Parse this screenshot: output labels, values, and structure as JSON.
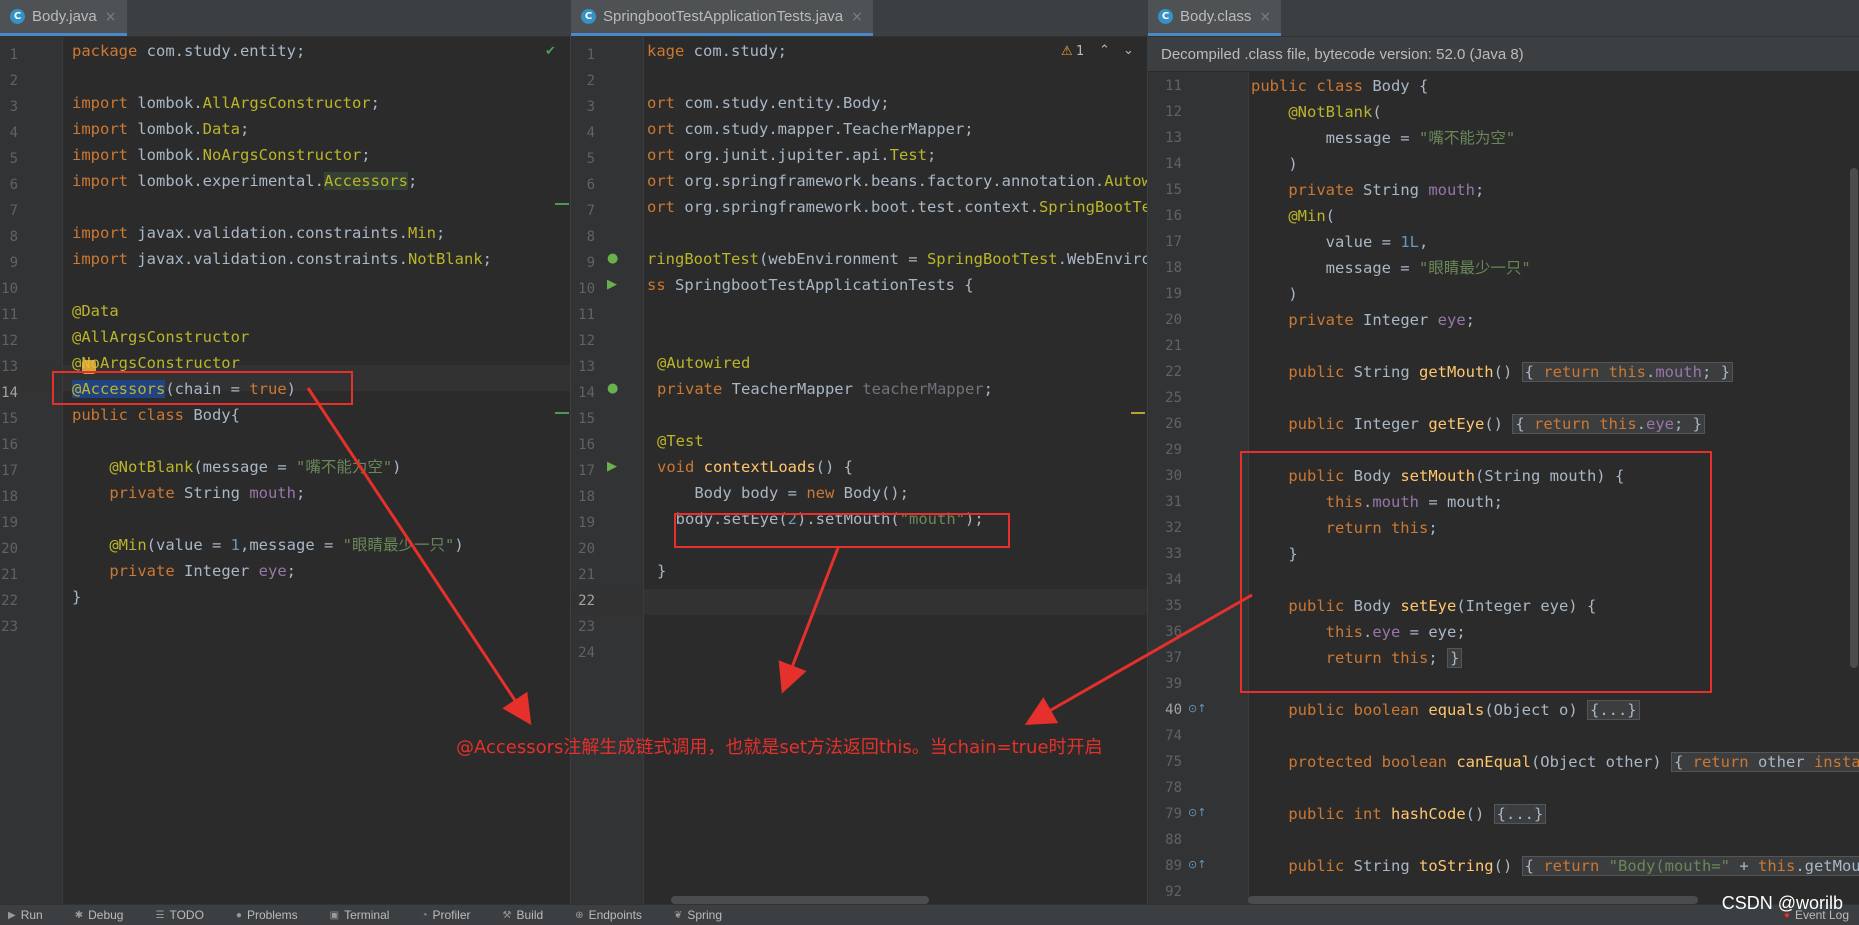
{
  "panes": [
    {
      "tab": {
        "letter": "C",
        "name": "Body.java",
        "close": "×"
      },
      "line_numbers": [
        "1",
        "2",
        "3",
        "4",
        "5",
        "6",
        "7",
        "8",
        "9",
        "10",
        "11",
        "12",
        "13",
        "14",
        "15",
        "16",
        "17",
        "18",
        "19",
        "20",
        "21",
        "22",
        "23"
      ],
      "current_line": "14",
      "checkmark": "✔"
    },
    {
      "tab": {
        "letter": "C",
        "name": "SpringbootTestApplicationTests.java",
        "close": "×"
      },
      "line_numbers": [
        "1",
        "2",
        "3",
        "4",
        "5",
        "6",
        "7",
        "8",
        "9",
        "10",
        "11",
        "12",
        "13",
        "14",
        "15",
        "16",
        "17",
        "18",
        "19",
        "20",
        "21",
        "22",
        "23",
        "24"
      ],
      "current_line": "22",
      "warnings": {
        "icon": "⚠",
        "count": "1"
      }
    },
    {
      "tab": {
        "letter": "C",
        "name": "Body.class",
        "close": "×"
      },
      "info": "Decompiled .class file, bytecode version: 52.0 (Java 8)",
      "line_numbers": [
        "11",
        "12",
        "13",
        "14",
        "15",
        "16",
        "17",
        "18",
        "19",
        "20",
        "21",
        "22",
        "25",
        "26",
        "29",
        "30",
        "31",
        "32",
        "33",
        "34",
        "35",
        "36",
        "37",
        "39",
        "40",
        "74",
        "75",
        "78",
        "79",
        "88",
        "89",
        "92"
      ]
    }
  ],
  "annotation": "@Accessors注解生成链式调用，也就是set方法返回this。当chain=true时开启",
  "watermark": "CSDN @worilb",
  "bottom_bar": [
    {
      "icon": "run-icon",
      "label": "Run"
    },
    {
      "icon": "debug-icon",
      "label": "Debug"
    },
    {
      "icon": "todo-icon",
      "label": "TODO"
    },
    {
      "icon": "problems-icon",
      "label": "Problems"
    },
    {
      "icon": "terminal-icon",
      "label": "Terminal"
    },
    {
      "icon": "profiler-icon",
      "label": "Profiler"
    },
    {
      "icon": "build-icon",
      "label": "Build"
    },
    {
      "icon": "endpoints-icon",
      "label": "Endpoints"
    },
    {
      "icon": "spring-icon",
      "label": "Spring"
    },
    {
      "icon": "event-log-icon",
      "label": "Event Log"
    }
  ],
  "colors": {
    "keyword": "#cc7832",
    "annotation": "#bbb529",
    "string": "#6a8759",
    "number": "#6897bb",
    "field": "#9876aa",
    "function": "#ffc66d",
    "highlight": "#e5302b"
  }
}
